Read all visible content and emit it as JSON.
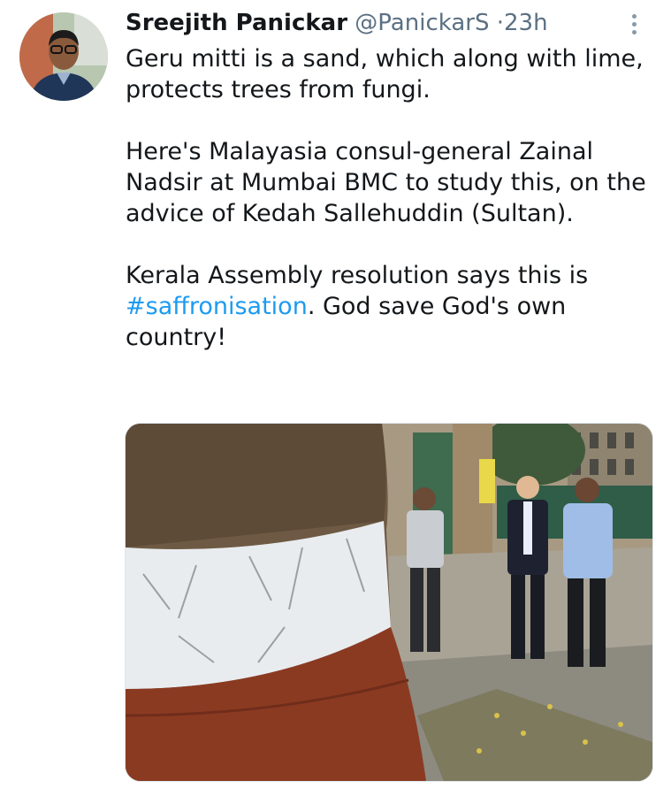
{
  "tweet": {
    "author_name": "Sreejith Panickar",
    "author_handle": "@PanickarS",
    "separator": "·",
    "time": "23h",
    "paragraphs": [
      "Geru mitti is a sand, which along with lime, protects trees from fungi.",
      "Here's Malayasia consul-general Zainal Nadsir at Mumbai BMC to study this, on the advice of Kedah Sallehuddin (Sultan)."
    ],
    "last_paragraph": {
      "text_before": "Kerala Assembly resolution says this is",
      "hashtag": "#saffronisation",
      "text_after": ". God save God's own country!"
    }
  },
  "icons": {
    "more": "more-vertical-icon",
    "avatar": "profile-photo"
  },
  "colors": {
    "hashtag": "#1d9bf0",
    "secondary_text": "#5b7083",
    "primary_text": "#14171a"
  }
}
